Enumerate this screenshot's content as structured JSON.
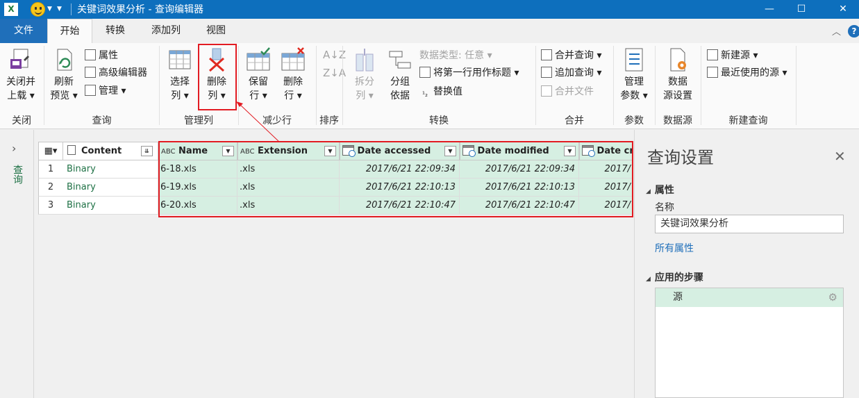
{
  "titlebar": {
    "app_icon": "X",
    "title": "关键词效果分析 - 查询编辑器",
    "minimize": "—",
    "maximize": "☐",
    "close": "✕"
  },
  "tabs": [
    "文件",
    "开始",
    "转换",
    "添加列",
    "视图"
  ],
  "ribbon": {
    "close_load": [
      "关闭并",
      "上载"
    ],
    "refresh": [
      "刷新",
      "预览"
    ],
    "properties": "属性",
    "advanced_editor": "高级编辑器",
    "manage": "管理",
    "choose_cols": [
      "选择",
      "列"
    ],
    "remove_cols": [
      "删除",
      "列"
    ],
    "keep_rows": [
      "保留",
      "行"
    ],
    "remove_rows": [
      "删除",
      "行"
    ],
    "split_col": [
      "拆分",
      "列"
    ],
    "group_by": [
      "分组",
      "依据"
    ],
    "data_type": "数据类型: 任意",
    "first_row_header": "将第一行用作标题",
    "replace_values": "替换值",
    "merge_queries": "合并查询",
    "append_queries": "追加查询",
    "combine_files": "合并文件",
    "manage_params": [
      "管理",
      "参数"
    ],
    "source_settings": [
      "数据",
      "源设置"
    ],
    "new_source": "新建源",
    "recent_sources": "最近使用的源",
    "groups": {
      "close": "关闭",
      "query": "查询",
      "manage_cols": "管理列",
      "reduce_rows": "减少行",
      "sort": "排序",
      "transform": "转换",
      "combine": "合并",
      "params": "参数",
      "data_source": "数据源",
      "new_query": "新建查询"
    }
  },
  "left_pane": {
    "label": "查询"
  },
  "grid": {
    "columns": [
      "Content",
      "Name",
      "Extension",
      "Date accessed",
      "Date modified",
      "Date cr"
    ],
    "rows": [
      {
        "num": "1",
        "content": "Binary",
        "name": "6-18.xls",
        "ext": ".xls",
        "accessed": "2017/6/21 22:09:34",
        "modified": "2017/6/21 22:09:34",
        "created": "2017/"
      },
      {
        "num": "2",
        "content": "Binary",
        "name": "6-19.xls",
        "ext": ".xls",
        "accessed": "2017/6/21 22:10:13",
        "modified": "2017/6/21 22:10:13",
        "created": "2017/"
      },
      {
        "num": "3",
        "content": "Binary",
        "name": "6-20.xls",
        "ext": ".xls",
        "accessed": "2017/6/21 22:10:47",
        "modified": "2017/6/21 22:10:47",
        "created": "2017/"
      }
    ]
  },
  "settings": {
    "title": "查询设置",
    "properties_header": "属性",
    "name_label": "名称",
    "name_value": "关键词效果分析",
    "all_properties": "所有属性",
    "steps_header": "应用的步骤",
    "steps": [
      "源"
    ]
  },
  "colors": {
    "accent": "#0d6fbd",
    "excel_green": "#1e7145",
    "selection": "#d6efe2",
    "highlight": "#e21b22"
  }
}
